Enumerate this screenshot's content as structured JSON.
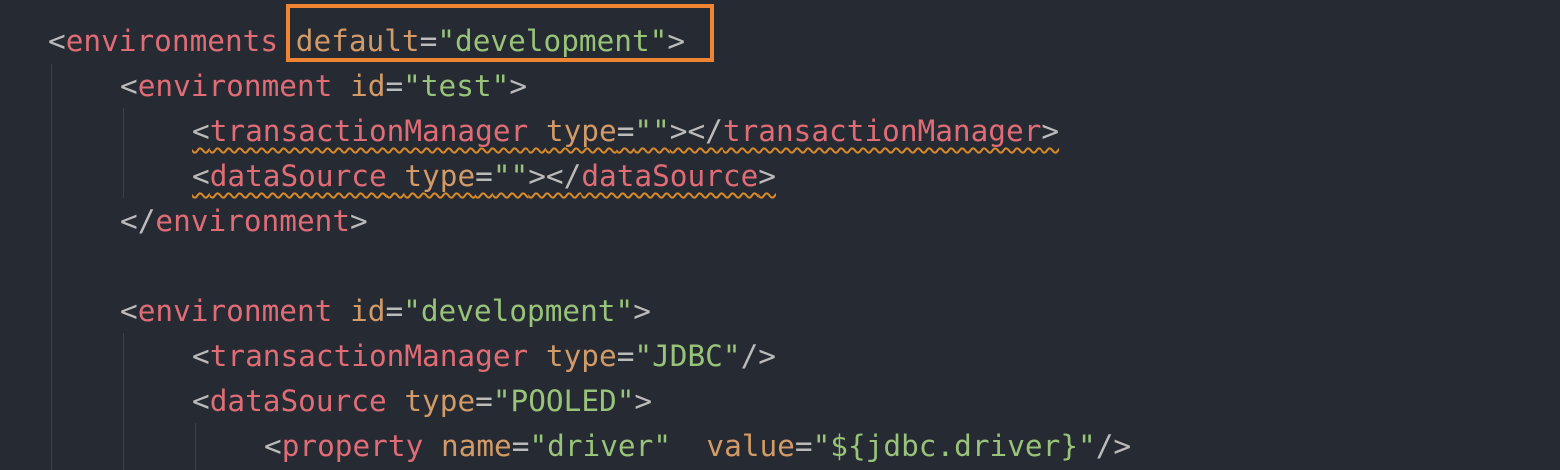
{
  "colors": {
    "background": "#262a33",
    "tag": "#e06c75",
    "attribute": "#d19a66",
    "value": "#98c379",
    "punctuation": "#bbbbbb",
    "highlight_box": "#ef8533",
    "warning_underline": "#d8892a"
  },
  "code": {
    "line1": {
      "lt": "<",
      "tag": "environments",
      "space": " ",
      "attr": "default",
      "eq": "=",
      "val": "\"development\"",
      "gt": ">"
    },
    "line2": {
      "lt": "<",
      "tag": "environment",
      "space": " ",
      "attr": "id",
      "eq": "=",
      "val": "\"test\"",
      "gt": ">"
    },
    "line3": {
      "lt": "<",
      "tag": "transactionManager",
      "space": " ",
      "attr": "type",
      "eq": "=",
      "val": "\"\"",
      "mid": "></",
      "close_tag": "transactionManager",
      "gt": ">"
    },
    "line4": {
      "lt": "<",
      "tag": "dataSource",
      "space": " ",
      "attr": "type",
      "eq": "=",
      "val": "\"\"",
      "mid": "></",
      "close_tag": "dataSource",
      "gt": ">"
    },
    "line5": {
      "lt": "</",
      "tag": "environment",
      "gt": ">"
    },
    "line7": {
      "lt": "<",
      "tag": "environment",
      "space": " ",
      "attr": "id",
      "eq": "=",
      "val": "\"development\"",
      "gt": ">"
    },
    "line8": {
      "lt": "<",
      "tag": "transactionManager",
      "space": " ",
      "attr": "type",
      "eq": "=",
      "val": "\"JDBC\"",
      "gt": "/>"
    },
    "line9": {
      "lt": "<",
      "tag": "dataSource",
      "space": " ",
      "attr": "type",
      "eq": "=",
      "val": "\"POOLED\"",
      "gt": ">"
    },
    "line10": {
      "lt": "<",
      "tag": "property",
      "space": " ",
      "attr": "name",
      "eq": "=",
      "val": "\"driver\"",
      "space2": "  ",
      "attr2": "value",
      "eq2": "=",
      "val2": "\"${jdbc.driver}\"",
      "gt": "/>"
    }
  }
}
